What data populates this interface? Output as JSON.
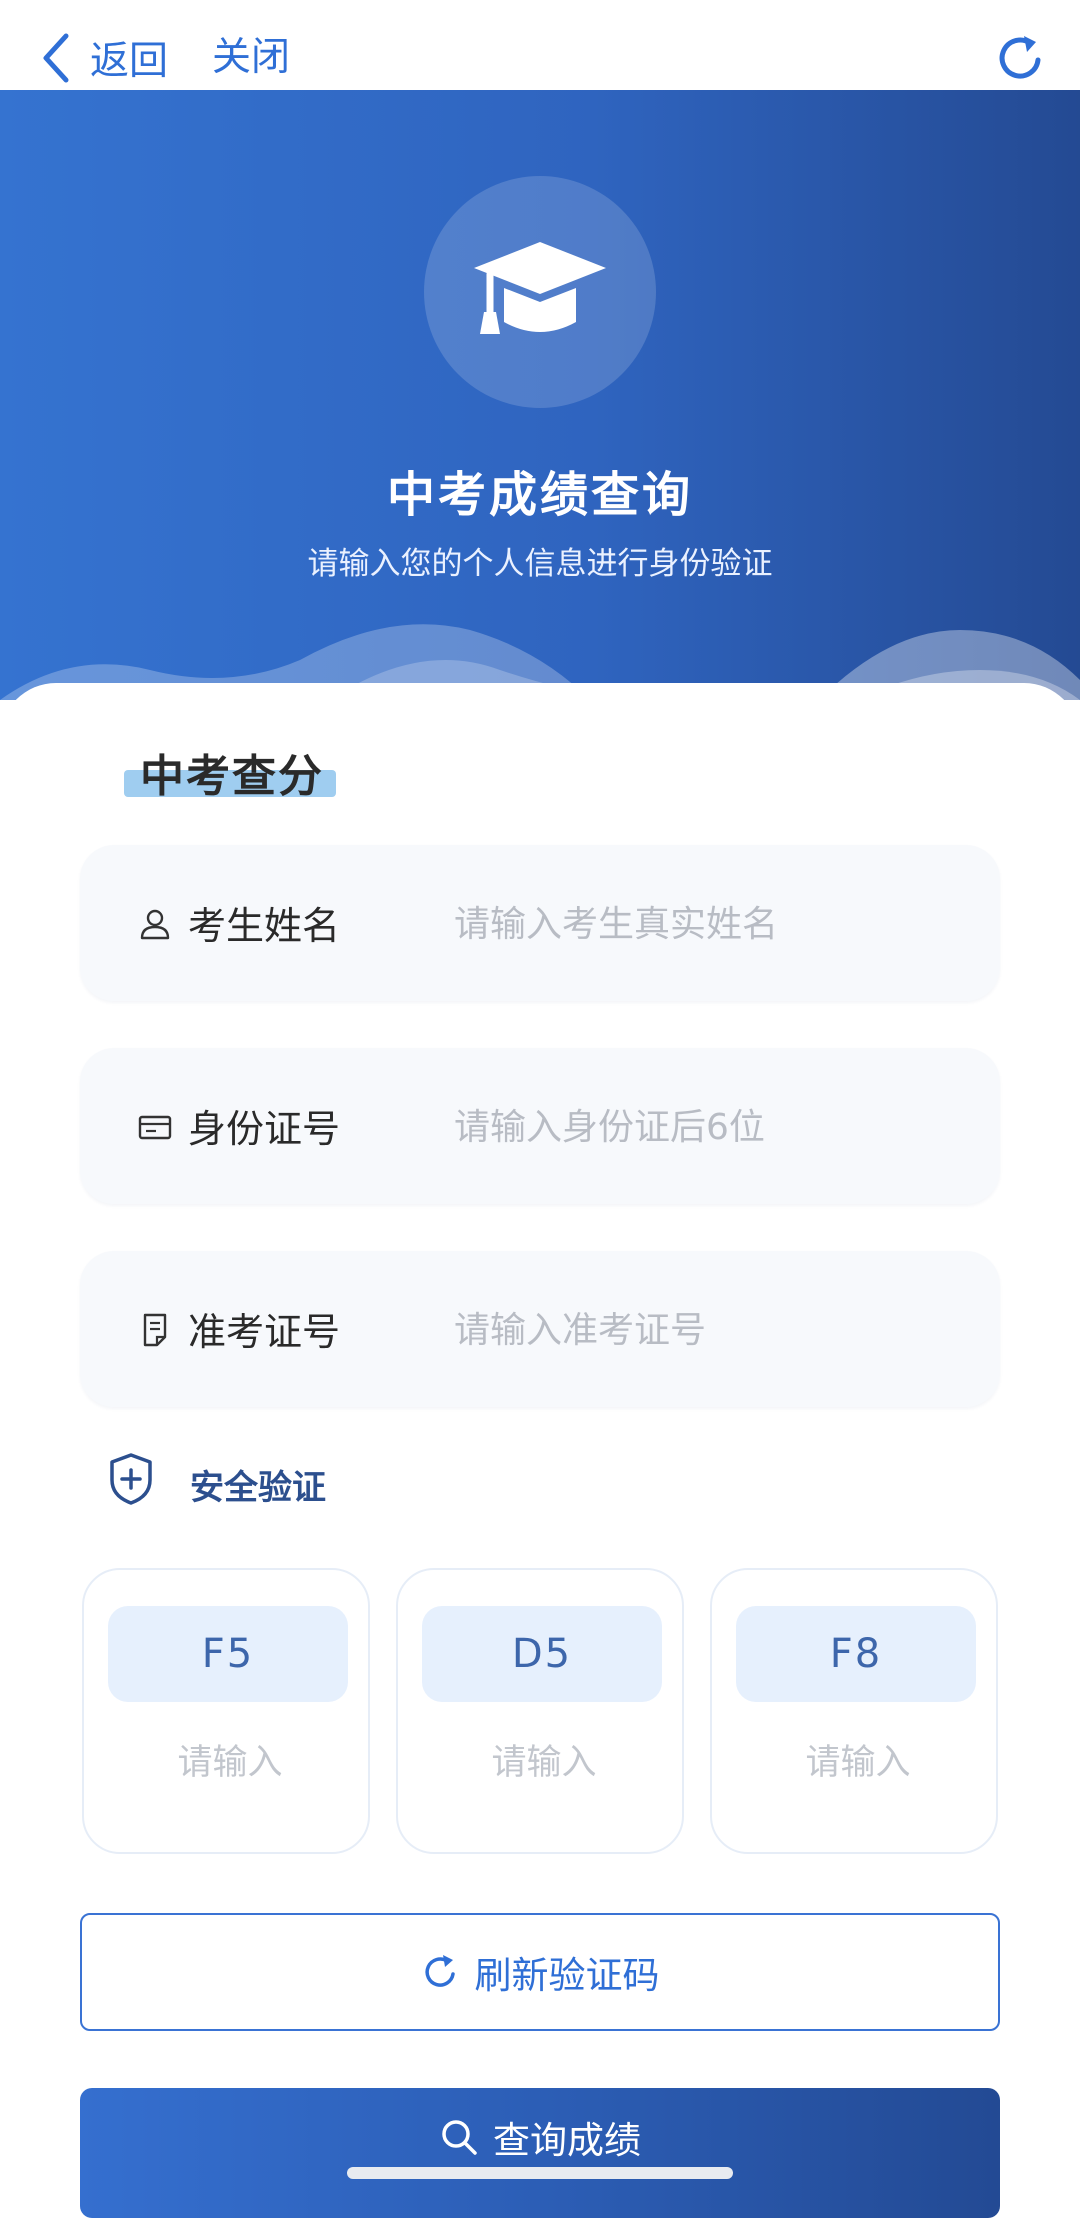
{
  "nav": {
    "back_label": "返回",
    "close_label": "关闭"
  },
  "hero": {
    "title": "中考成绩查询",
    "subtitle": "请输入您的个人信息进行身份验证"
  },
  "form": {
    "section_title": "中考查分",
    "fields": [
      {
        "label": "考生姓名",
        "placeholder": "请输入考生真实姓名",
        "icon": "user-icon"
      },
      {
        "label": "身份证号",
        "placeholder": "请输入身份证后6位",
        "icon": "id-card-icon"
      },
      {
        "label": "准考证号",
        "placeholder": "请输入准考证号",
        "icon": "ticket-icon"
      }
    ]
  },
  "security": {
    "label": "安全验证",
    "icon": "shield-plus-icon",
    "captchas": [
      {
        "code": "F5",
        "placeholder": "请输入"
      },
      {
        "code": "D5",
        "placeholder": "请输入"
      },
      {
        "code": "F8",
        "placeholder": "请输入"
      }
    ],
    "refresh_label": "刷新验证码"
  },
  "submit": {
    "label": "查询成绩"
  },
  "colors": {
    "accent": "#2f6fd6",
    "hero_start": "#3573d0",
    "hero_end": "#244a93",
    "code_bg": "#e6f0fd",
    "field_bg": "#f7f9fc"
  }
}
